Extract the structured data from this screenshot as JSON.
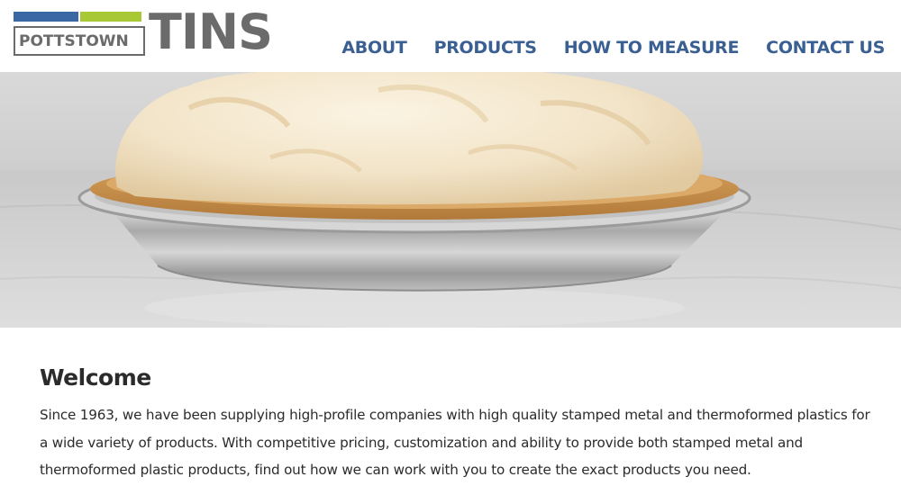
{
  "brand": {
    "small_text": "POTTSTOWN",
    "big_text": "TINS",
    "colors": {
      "logo_blue": "#3a68a4",
      "logo_green": "#a8c935",
      "logo_gray": "#6b6b6b"
    }
  },
  "nav": {
    "items": [
      {
        "label": "ABOUT"
      },
      {
        "label": "PRODUCTS"
      },
      {
        "label": "HOW TO MEASURE"
      },
      {
        "label": "CONTACT US"
      }
    ],
    "color": "#3a5f92"
  },
  "hero": {
    "subject": "meringue pie in aluminum tin"
  },
  "main": {
    "title": "Welcome",
    "body": "Since 1963, we have been supplying high-profile companies with high quality stamped metal and thermoformed plastics for a wide variety of products. With competitive pricing, customization and ability to provide both stamped metal and thermoformed plastic products, find out how we can work with you to create the exact products you need."
  }
}
